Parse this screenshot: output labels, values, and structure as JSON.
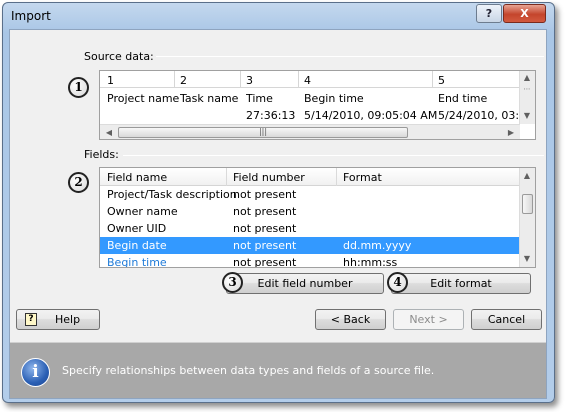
{
  "window": {
    "title": "Import",
    "help_symbol": "?",
    "close_symbol": "X"
  },
  "source_group": {
    "label": "Source data:"
  },
  "source_grid": {
    "columns": [
      "1",
      "2",
      "3",
      "4",
      "5"
    ],
    "row1": [
      "Project name",
      "Task name",
      "Time",
      "Begin time",
      "End time"
    ],
    "row2": [
      "",
      "",
      "27:36:13",
      "5/14/2010, 09:05:04 AM",
      "5/24/2010, 03:4"
    ]
  },
  "fields_group": {
    "label": "Fields:"
  },
  "fields_table": {
    "headers": [
      "Field name",
      "Field number",
      "Format"
    ],
    "rows": [
      {
        "name": "Project/Task description",
        "number": "not present",
        "format": ""
      },
      {
        "name": "Owner name",
        "number": "not present",
        "format": ""
      },
      {
        "name": "Owner UID",
        "number": "not present",
        "format": ""
      },
      {
        "name": "Begin date",
        "number": "not present",
        "format": "dd.mm.yyyy"
      },
      {
        "name": "Begin time",
        "number": "not present",
        "format": "hh:mm:ss"
      }
    ]
  },
  "markers": [
    "1",
    "2",
    "3",
    "4"
  ],
  "buttons": {
    "edit_field_number": "Edit field number",
    "edit_format": "Edit format",
    "help": "Help",
    "back": "< Back",
    "next": "Next >",
    "cancel": "Cancel"
  },
  "info": {
    "icon_glyph": "i",
    "text": "Specify relationships between data types and fields of a source file."
  },
  "colors": {
    "selection": "#3399ff",
    "link": "#1e7ad8",
    "info_bar": "#a8a8a8"
  }
}
